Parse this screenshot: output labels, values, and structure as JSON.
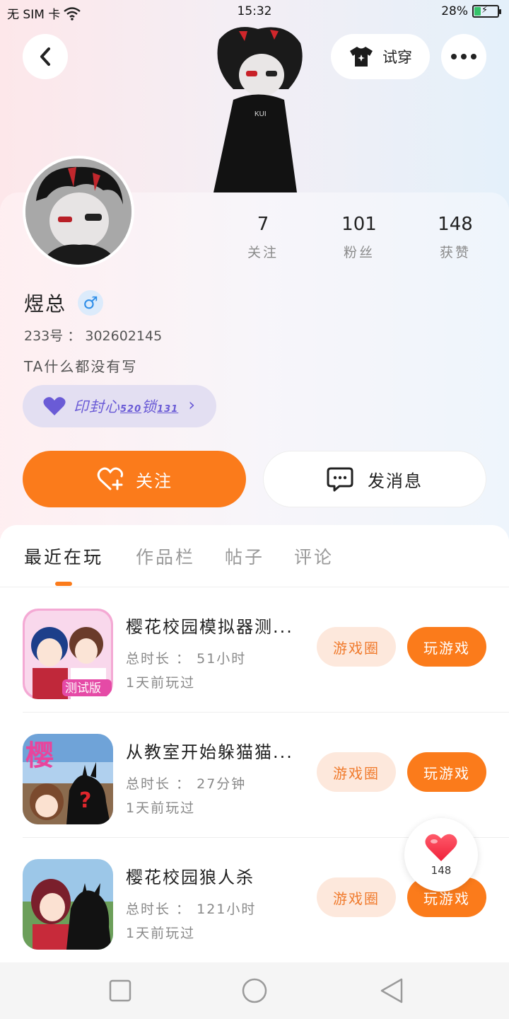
{
  "status_bar": {
    "carrier": "无 SIM 卡",
    "time": "15:32",
    "battery": "28%",
    "battery_level": 0.28
  },
  "toolbar": {
    "tryon_label": "试穿"
  },
  "profile": {
    "stats": [
      {
        "value": "7",
        "label": "关注"
      },
      {
        "value": "101",
        "label": "粉丝"
      },
      {
        "value": "148",
        "label": "获赞"
      }
    ],
    "name": "煜总",
    "gender_symbol": "♂",
    "uid_label": "233号",
    "uid_value": "302602145",
    "bio": "TA什么都没有写",
    "badge": {
      "text": "印封心",
      "num_a": "520",
      "lock": "锁",
      "num_b": "131"
    }
  },
  "actions": {
    "follow_label": "关注",
    "message_label": "发消息"
  },
  "tabs": [
    "最近在玩",
    "作品栏",
    "帖子",
    "评论"
  ],
  "games": [
    {
      "title": "樱花校园模拟器测...",
      "duration_label": "总时长",
      "duration": "51小时",
      "last_played": "1天前玩过",
      "circle_label": "游戏圈",
      "play_label": "玩游戏"
    },
    {
      "title": "从教室开始躲猫猫...",
      "duration_label": "总时长",
      "duration": "27分钟",
      "last_played": "1天前玩过",
      "circle_label": "游戏圈",
      "play_label": "玩游戏"
    },
    {
      "title": "樱花校园狼人杀",
      "duration_label": "总时长",
      "duration": "121小时",
      "last_played": "1天前玩过",
      "circle_label": "游戏圈",
      "play_label": "玩游戏"
    }
  ],
  "game_icon_texts": {
    "test_badge": "测试版",
    "sakura_char": "樱",
    "question": "?"
  },
  "like_fab": {
    "count": "148"
  },
  "colors": {
    "accent": "#fb7b1b",
    "chip_bg": "#fde8dc",
    "badge_purple": "#6a5bd6",
    "gender_blue": "#2f8ee8"
  }
}
